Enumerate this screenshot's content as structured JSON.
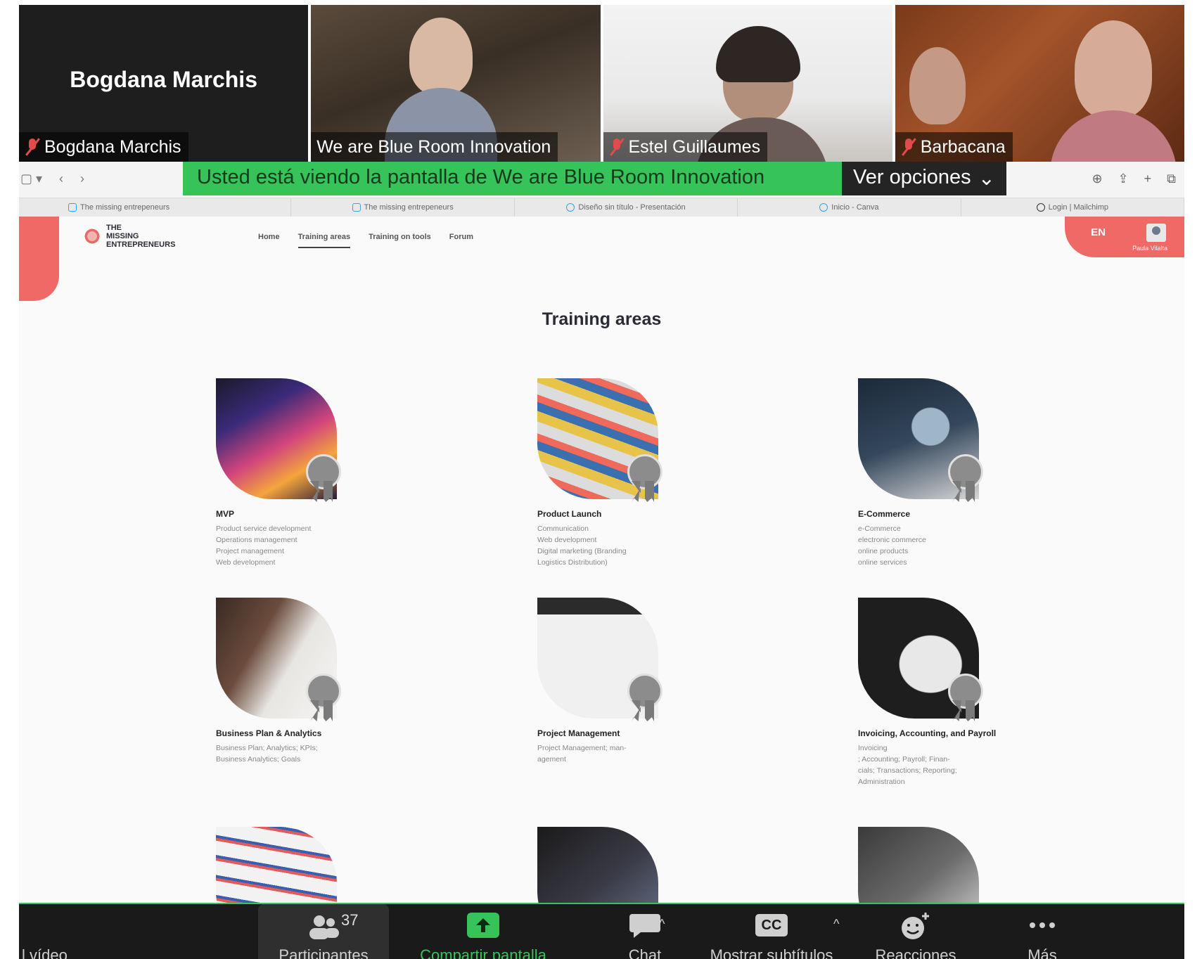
{
  "participants": [
    {
      "name": "Bogdana Marchis",
      "display": "Bogdana Marchis",
      "muted": true
    },
    {
      "name": "We are Blue Room Innovation",
      "muted": false
    },
    {
      "name": "Estel Guillaumes",
      "muted": true
    },
    {
      "name": "Barbacana",
      "muted": true
    }
  ],
  "share": {
    "message": "Usted está viendo la pantalla de We are Blue Room Innovation",
    "options_label": "Ver opciones"
  },
  "tabs": [
    {
      "label": "The missing entrepeneurs"
    },
    {
      "label": "The missing entrepeneurs"
    },
    {
      "label": "Diseño sin título - Presentación"
    },
    {
      "label": "Inicio - Canva"
    },
    {
      "label": "Login | Mailchimp"
    }
  ],
  "site": {
    "logo_lines": [
      "THE",
      "MISSING",
      "ENTREPRENEURS"
    ],
    "nav": [
      "Home",
      "Training areas",
      "Training on tools",
      "Forum"
    ],
    "lang": "EN",
    "user_name": "Paula Vilalta",
    "page_title": "Training areas"
  },
  "cards": [
    {
      "title": "MVP",
      "lines": [
        "Product service development",
        "Operations management",
        "Project management",
        "Web development"
      ]
    },
    {
      "title": "Product Launch",
      "lines": [
        "Communication",
        "Web development",
        "Digital marketing (Branding",
        "Logistics Distribution)"
      ]
    },
    {
      "title": "E-Commerce",
      "lines": [
        "e-Commerce",
        "electronic commerce",
        "online products",
        "online services"
      ]
    },
    {
      "title": "Business Plan & Analytics",
      "lines": [
        "Business Plan; Analytics; KPIs;",
        "Business Analytics; Goals"
      ]
    },
    {
      "title": "Project Management",
      "lines": [
        "Project Management; man-",
        "agement"
      ]
    },
    {
      "title": "Invoicing, Accounting, and Payroll",
      "lines": [
        "Invoicing",
        "; Accounting; Payroll; Finan-",
        "cials; Transactions; Reporting;",
        "Administration"
      ]
    }
  ],
  "toolbar": {
    "video_label": "l vídeo",
    "participants_label": "Participantes",
    "participants_count": "37",
    "share_label": "Compartir pantalla",
    "chat_label": "Chat",
    "captions_label": "Mostrar subtítulos",
    "captions_icon_text": "CC",
    "reactions_label": "Reacciones",
    "more_label": "Más"
  },
  "icons": {
    "mic": "mic-off-icon",
    "participants": "people-icon",
    "share": "share-screen-icon",
    "chat": "chat-bubble-icon",
    "reactions": "smiley-plus-icon",
    "more": "ellipsis-icon"
  },
  "colors": {
    "zoom_green": "#35c35a",
    "coral": "#ef6a66",
    "toolbar_bg": "#1a1a1a"
  }
}
